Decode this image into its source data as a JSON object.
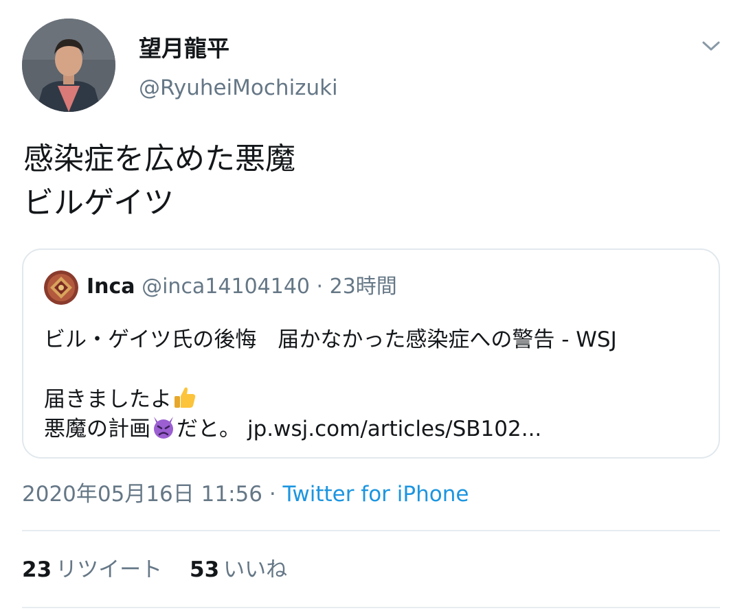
{
  "author": {
    "display_name": "望月龍平",
    "handle": "@RyuheiMochizuki",
    "avatar": "author-avatar"
  },
  "tweet": {
    "lines": [
      "感染症を広めた悪魔",
      "ビルゲイツ"
    ]
  },
  "quoted_tweet": {
    "name": "Inca",
    "handle": "@inca14104140",
    "separator": " · ",
    "time": "23時間",
    "line1": "ビル・ゲイツ氏の後悔　届かなかった感染症への警告 - WSJ",
    "line2": "届きましたよ",
    "line2_emoji": "thumbs-up-emoji",
    "line3_prefix": "悪魔の計画",
    "line3_emoji": "angry-devil-emoji",
    "line3_suffix": "だと。",
    "link": "jp.wsj.com/articles/SB102..."
  },
  "meta": {
    "timestamp": "2020年05月16日 11:56",
    "separator": " · ",
    "source": "Twitter for iPhone"
  },
  "stats": {
    "retweets_count": "23",
    "retweets_label": "リツイート",
    "likes_count": "53",
    "likes_label": "いいね"
  },
  "icons": {
    "menu": "chevron-down-icon"
  },
  "colors": {
    "text": "#14171a",
    "secondary": "#657786",
    "link": "#1b95e0",
    "border": "#e1e8ed"
  }
}
